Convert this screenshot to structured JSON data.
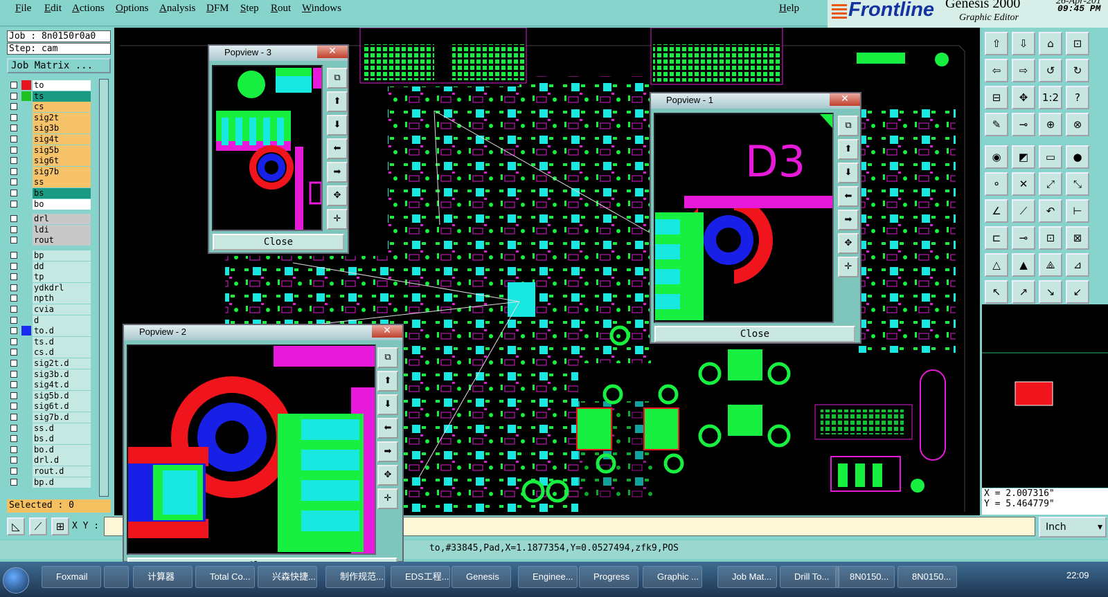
{
  "menu": {
    "items": [
      "File",
      "Edit",
      "Actions",
      "Options",
      "Analysis",
      "DFM",
      "Step",
      "Rout",
      "Windows"
    ],
    "help": "Help"
  },
  "brand": {
    "logo": "Frontline",
    "product": "Genesis 2000",
    "subtitle": "Graphic Editor",
    "date": "26-Apr-201",
    "time": "09:45 PM"
  },
  "job": {
    "job": "Job : 8n0150r0a0",
    "step": "Step: cam",
    "matrix": "Job Matrix ..."
  },
  "layers": [
    {
      "name": "to",
      "color": "#ffffff",
      "sw": "#e8141e"
    },
    {
      "name": "ts",
      "color": "#1a9a82",
      "sw": "#1fc021"
    },
    {
      "name": "cs",
      "color": "#f6c36a",
      "sw": ""
    },
    {
      "name": "sig2t",
      "color": "#f6c36a",
      "sw": ""
    },
    {
      "name": "sig3b",
      "color": "#f6c36a",
      "sw": ""
    },
    {
      "name": "sig4t",
      "color": "#f6c36a",
      "sw": ""
    },
    {
      "name": "sig5b",
      "color": "#f6c36a",
      "sw": ""
    },
    {
      "name": "sig6t",
      "color": "#f6c36a",
      "sw": ""
    },
    {
      "name": "sig7b",
      "color": "#f6c36a",
      "sw": ""
    },
    {
      "name": "ss",
      "color": "#f6c36a",
      "sw": ""
    },
    {
      "name": "bs",
      "color": "#1a9a82",
      "sw": ""
    },
    {
      "name": "bo",
      "color": "#ffffff",
      "sw": ""
    },
    {
      "name": "drl",
      "color": "#c8c8c8",
      "sw": ""
    },
    {
      "name": "ldi",
      "color": "#c8c8c8",
      "sw": ""
    },
    {
      "name": "rout",
      "color": "#c8c8c8",
      "sw": ""
    },
    {
      "name": "bp",
      "color": "#c6e8e2",
      "sw": ""
    },
    {
      "name": "dd",
      "color": "#c6e8e2",
      "sw": ""
    },
    {
      "name": "tp",
      "color": "#c6e8e2",
      "sw": ""
    },
    {
      "name": "ydkdrl",
      "color": "#c6e8e2",
      "sw": ""
    },
    {
      "name": "npth",
      "color": "#c6e8e2",
      "sw": ""
    },
    {
      "name": "cvia",
      "color": "#c6e8e2",
      "sw": ""
    },
    {
      "name": "d",
      "color": "#c6e8e2",
      "sw": ""
    },
    {
      "name": "to.d",
      "color": "#c6e8e2",
      "sw": "#1a2cf2"
    },
    {
      "name": "ts.d",
      "color": "#c6e8e2",
      "sw": ""
    },
    {
      "name": "cs.d",
      "color": "#c6e8e2",
      "sw": ""
    },
    {
      "name": "sig2t.d",
      "color": "#c6e8e2",
      "sw": ""
    },
    {
      "name": "sig3b.d",
      "color": "#c6e8e2",
      "sw": ""
    },
    {
      "name": "sig4t.d",
      "color": "#c6e8e2",
      "sw": ""
    },
    {
      "name": "sig5b.d",
      "color": "#c6e8e2",
      "sw": ""
    },
    {
      "name": "sig6t.d",
      "color": "#c6e8e2",
      "sw": ""
    },
    {
      "name": "sig7b.d",
      "color": "#c6e8e2",
      "sw": ""
    },
    {
      "name": "ss.d",
      "color": "#c6e8e2",
      "sw": ""
    },
    {
      "name": "bs.d",
      "color": "#c6e8e2",
      "sw": ""
    },
    {
      "name": "bo.d",
      "color": "#c6e8e2",
      "sw": ""
    },
    {
      "name": "drl.d",
      "color": "#c6e8e2",
      "sw": ""
    },
    {
      "name": "rout.d",
      "color": "#c6e8e2",
      "sw": ""
    },
    {
      "name": "bp.d",
      "color": "#c6e8e2",
      "sw": ""
    }
  ],
  "selected": "Selected : 0",
  "xy_label": "X Y :",
  "units": "Inch",
  "coords": {
    "x": "X = 2.007316\"",
    "y": "Y = 5.464779\""
  },
  "status": "to,#33845,Pad,X=1.1877354,Y=0.0527494,zfk9,POS",
  "popups": {
    "p1": "Popview - 1",
    "p2": "Popview - 2",
    "p3": "Popview - 3",
    "close": "Close",
    "label": "D3"
  },
  "colors": {
    "green": "#17f040",
    "cyan": "#18e8e0",
    "red": "#f0141c",
    "magenta": "#e61ad8",
    "blue": "#1820e8"
  },
  "taskbar": [
    "Foxmail",
    "",
    "计算器",
    "Total Co...",
    "兴森快捷...",
    "制作规范...",
    "EDS工程...",
    "Genesis",
    "Enginee...",
    "Progress",
    "Graphic ...",
    "Job Mat...",
    "Drill To...",
    "8N0150...",
    "8N0150..."
  ],
  "clock": "22:09"
}
